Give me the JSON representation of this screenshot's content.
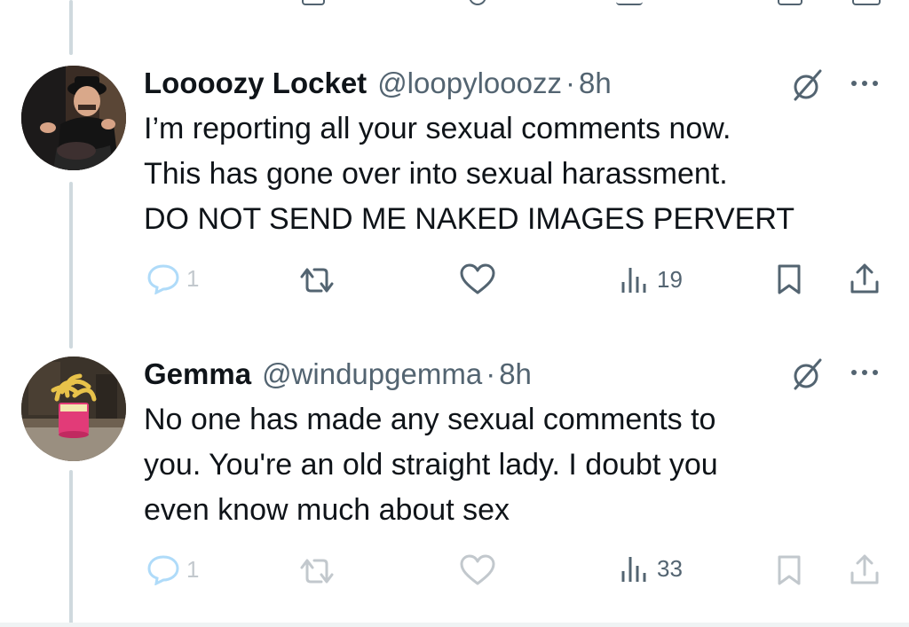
{
  "tweets": [
    {
      "name": "Loooozy Locket",
      "handle": "@loopylooozz",
      "separator": "·",
      "time": "8h",
      "lines": [
        "I’m reporting all your sexual comments now.",
        "This has gone over into sexual harassment.",
        "DO NOT SEND ME NAKED IMAGES PERVERT"
      ],
      "replies": "1",
      "views": "19",
      "icons": [
        "reply-icon",
        "retweet-icon",
        "like-icon",
        "views-icon",
        "bookmark-icon",
        "share-icon"
      ]
    },
    {
      "name": "Gemma",
      "handle": "@windupgemma",
      "separator": "·",
      "time": "8h",
      "lines": [
        "No one has made any sexual comments to",
        "you. You're an old straight lady. I doubt you",
        "even know much about sex"
      ],
      "replies": "1",
      "views": "33",
      "icons": [
        "reply-icon",
        "retweet-icon",
        "like-icon",
        "views-icon",
        "bookmark-icon",
        "share-icon"
      ]
    }
  ],
  "colors": {
    "text": "#0f1419",
    "secondary": "#536471",
    "thread_line": "#cfd9de",
    "reply_faded": "#1d9bf0"
  }
}
